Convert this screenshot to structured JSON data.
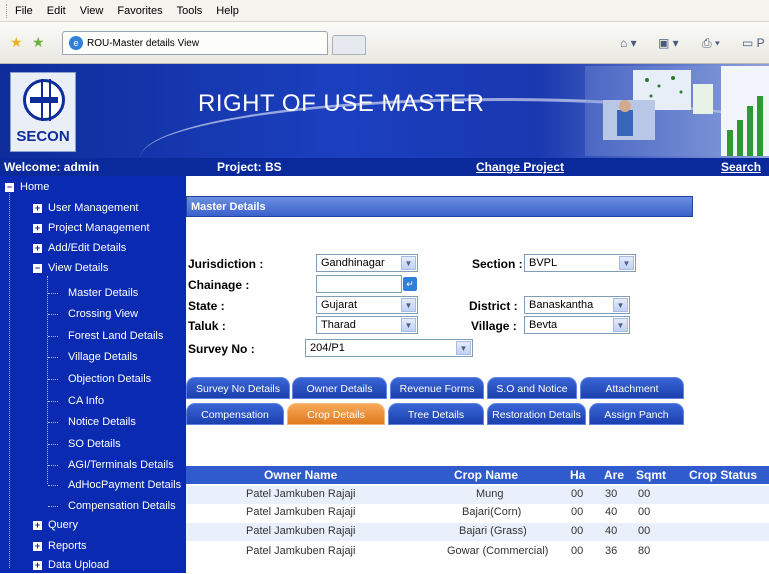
{
  "browser": {
    "menu": [
      "File",
      "Edit",
      "View",
      "Favorites",
      "Tools",
      "Help"
    ],
    "tab_title": "ROU-Master details View",
    "icons": [
      "favorites-star-icon",
      "add-favorites-icon",
      "home-icon",
      "feeds-icon",
      "print-icon",
      "page-icon"
    ]
  },
  "banner": {
    "logo_text": "SECON",
    "title": "RIGHT OF USE MASTER"
  },
  "navstrip": {
    "welcome": "Welcome: admin",
    "project": "Project: BS",
    "change_project": "Change Project",
    "search": "Search"
  },
  "sidebar": {
    "home": "Home",
    "items": [
      {
        "label": "User Management",
        "state": "collapsed"
      },
      {
        "label": "Project Management",
        "state": "collapsed"
      },
      {
        "label": "Add/Edit Details",
        "state": "collapsed"
      },
      {
        "label": "View Details",
        "state": "expanded"
      }
    ],
    "subitems": [
      "Master Details",
      "Crossing View",
      "Forest Land Details",
      "Village Details",
      "Objection Details",
      "CA Info",
      "Notice Details",
      "SO Details",
      "AGI/Terminals Details",
      "AdHocPayment Details",
      "Compensation Details"
    ],
    "bottom_items": [
      "Query",
      "Reports",
      "Data Upload"
    ]
  },
  "main": {
    "section_title": "Master Details",
    "form": {
      "jurisdiction_label": "Jurisdiction :",
      "jurisdiction_value": "Gandhinagar",
      "section_label": "Section :",
      "section_value": "BVPL",
      "chainage_label": "Chainage :",
      "chainage_value": "",
      "state_label": "State :",
      "state_value": "Gujarat",
      "district_label": "District :",
      "district_value": "Banaskantha",
      "taluk_label": "Taluk :",
      "taluk_value": "Tharad",
      "village_label": "Village :",
      "village_value": "Bevta",
      "survey_label": "Survey No :",
      "survey_value": "204/P1"
    },
    "tabs_row1": [
      "Survey No Details",
      "Owner Details",
      "Revenue Forms",
      "S.O and Notice",
      "Attachment"
    ],
    "tabs_row2": [
      "Compensation",
      "Crop Details",
      "Tree Details",
      "Restoration Details",
      "Assign Panch"
    ],
    "active_tab": "Crop Details",
    "table": {
      "headers": [
        "Owner Name",
        "Crop Name",
        "Ha",
        "Are",
        "Sqmt",
        "Crop Status"
      ],
      "rows": [
        [
          "Patel Jamkuben Rajaji",
          "Mung",
          "00",
          "30",
          "00",
          ""
        ],
        [
          "Patel Jamkuben Rajaji",
          "Bajari(Corn)",
          "00",
          "40",
          "00",
          ""
        ],
        [
          "Patel Jamkuben Rajaji",
          "Bajari (Grass)",
          "00",
          "40",
          "00",
          ""
        ],
        [
          "Patel Jamkuben Rajaji",
          "Gowar (Commercial)",
          "00",
          "36",
          "80",
          ""
        ]
      ]
    }
  }
}
